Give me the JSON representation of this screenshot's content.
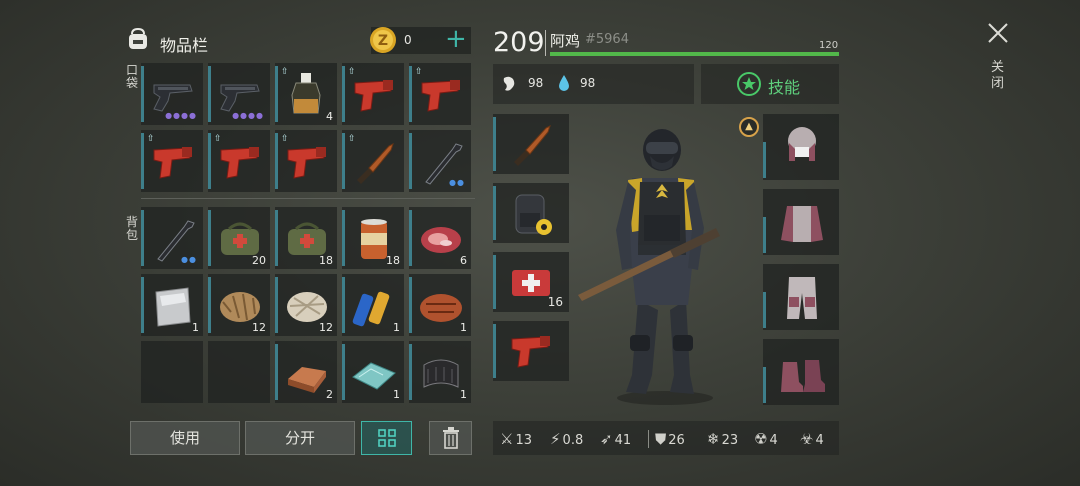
{
  "inventory": {
    "title": "物品栏",
    "coins": "0",
    "pocket_label": "口袋",
    "backpack_label": "背包",
    "pocket_slots": [
      {
        "icon": "pistol-icon",
        "count": "",
        "dots": "●●●●",
        "dot_color": "#8b6fd6",
        "tag": false
      },
      {
        "icon": "pistol-icon",
        "count": "",
        "dots": "●●●●",
        "dot_color": "#8b6fd6",
        "tag": false
      },
      {
        "icon": "molotov-icon",
        "count": "4",
        "dots": "",
        "dot_color": "",
        "tag": true
      },
      {
        "icon": "flare-gun-icon",
        "count": "",
        "dots": "",
        "dot_color": "",
        "tag": true
      },
      {
        "icon": "flare-gun-icon",
        "count": "",
        "dots": "",
        "dot_color": "",
        "tag": true
      },
      {
        "icon": "flare-gun-icon",
        "count": "",
        "dots": "",
        "dot_color": "",
        "tag": true
      },
      {
        "icon": "flare-gun-icon",
        "count": "",
        "dots": "",
        "dot_color": "",
        "tag": true
      },
      {
        "icon": "flare-gun-icon",
        "count": "",
        "dots": "",
        "dot_color": "",
        "tag": true
      },
      {
        "icon": "knife-icon",
        "count": "",
        "dots": "",
        "dot_color": "",
        "tag": true
      },
      {
        "icon": "crowbar-icon",
        "count": "",
        "dots": "●●",
        "dot_color": "#4b8fe0",
        "tag": false
      }
    ],
    "backpack_slots": [
      {
        "icon": "crowbar-icon",
        "count": "",
        "dots": "●●",
        "dot_color": "#4b8fe0"
      },
      {
        "icon": "medkit-bag-icon",
        "count": "20",
        "dots": "",
        "dot_color": ""
      },
      {
        "icon": "medkit-bag-icon",
        "count": "18",
        "dots": "",
        "dot_color": ""
      },
      {
        "icon": "canned-food-icon",
        "count": "18",
        "dots": "",
        "dot_color": ""
      },
      {
        "icon": "raw-meat-icon",
        "count": "6",
        "dots": "",
        "dot_color": ""
      },
      {
        "icon": "metal-sheet-icon",
        "count": "1",
        "dots": "",
        "dot_color": ""
      },
      {
        "icon": "fur-icon",
        "count": "12",
        "dots": "",
        "dot_color": ""
      },
      {
        "icon": "fiber-icon",
        "count": "12",
        "dots": "",
        "dot_color": ""
      },
      {
        "icon": "battery-icon",
        "count": "1",
        "dots": "",
        "dot_color": ""
      },
      {
        "icon": "cooked-meat-icon",
        "count": "1",
        "dots": "",
        "dot_color": ""
      },
      {
        "icon": "",
        "count": "",
        "dots": "",
        "dot_color": ""
      },
      {
        "icon": "",
        "count": "",
        "dots": "",
        "dot_color": ""
      },
      {
        "icon": "copper-ingot-icon",
        "count": "2",
        "dots": "",
        "dot_color": ""
      },
      {
        "icon": "glass-icon",
        "count": "1",
        "dots": "",
        "dot_color": ""
      },
      {
        "icon": "rubber-icon",
        "count": "1",
        "dots": "",
        "dot_color": ""
      }
    ],
    "buttons": {
      "use": "使用",
      "split": "分开"
    }
  },
  "character": {
    "level": "209",
    "name": "阿鸡",
    "id": "#5964",
    "hp": "120",
    "hunger": "98",
    "thirst": "98",
    "skills_label": "技能",
    "close_label": "关闭",
    "hp_fraction": 1.0,
    "stats": [
      {
        "icon": "damage-icon",
        "value": "13"
      },
      {
        "icon": "attack-speed-icon",
        "value": "0.8"
      },
      {
        "icon": "speed-icon",
        "value": "41"
      },
      {
        "icon": "armor-icon",
        "value": "26"
      },
      {
        "icon": "cold-resist-icon",
        "value": "23"
      },
      {
        "icon": "radiation-icon",
        "value": "4"
      },
      {
        "icon": "toxic-icon",
        "value": "4"
      }
    ],
    "left_equipment": [
      {
        "icon": "knife-icon",
        "count": ""
      },
      {
        "icon": "backpack-icon",
        "count": ""
      },
      {
        "icon": "first-aid-kit-icon",
        "count": "16"
      },
      {
        "icon": "flare-gun-icon",
        "count": ""
      }
    ],
    "right_equipment": [
      {
        "icon": "hat-icon"
      },
      {
        "icon": "jacket-icon"
      },
      {
        "icon": "pants-icon"
      },
      {
        "icon": "boots-icon"
      }
    ]
  },
  "colors": {
    "accent": "#3fb6a8",
    "hp": "#52b84a",
    "slot_bar": "#3e7f8b"
  }
}
